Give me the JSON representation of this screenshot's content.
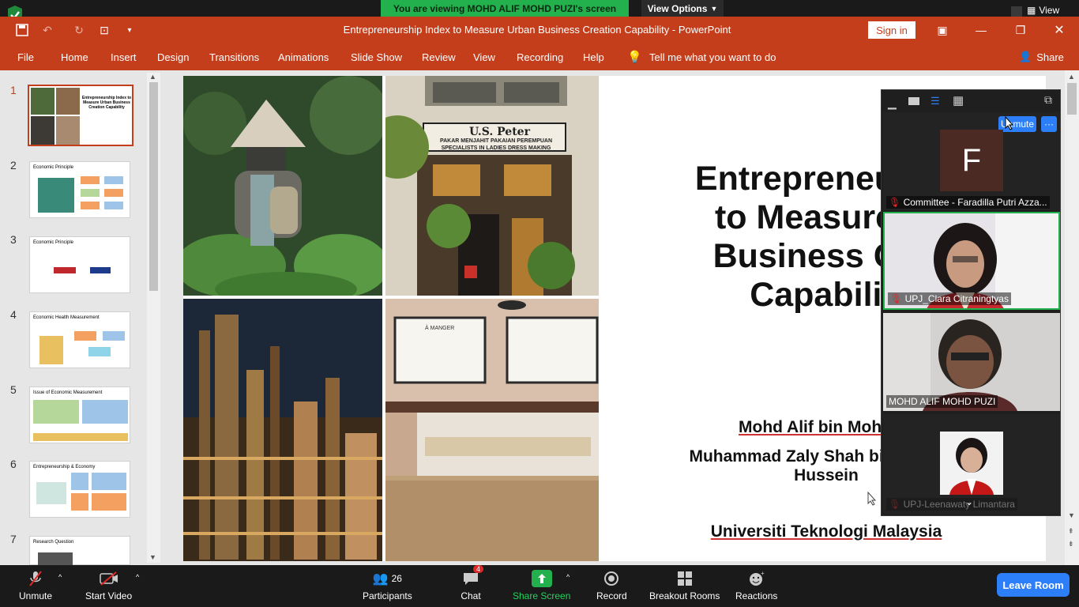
{
  "zoom": {
    "share_banner": "You are viewing MOHD ALIF MOHD PUZI's screen",
    "view_options": "View Options",
    "top_view": "View",
    "bottom": {
      "unmute": "Unmute",
      "start_video": "Start Video",
      "participants": "Participants",
      "participants_count": "26",
      "chat": "Chat",
      "chat_badge": "4",
      "share_screen": "Share Screen",
      "record": "Record",
      "breakout_rooms": "Breakout Rooms",
      "reactions": "Reactions",
      "leave_room": "Leave Room"
    },
    "gallery": {
      "unmute_label": "Unmute",
      "more_label": "···",
      "participants": [
        {
          "name": "Committee - Faradilla Putri Azza...",
          "avatar_letter": "F",
          "muted": true
        },
        {
          "name": "UPJ_Clara Citraningtyas",
          "muted": true
        },
        {
          "name": "MOHD ALIF MOHD PUZI",
          "muted": false
        },
        {
          "name": "UPJ-Leenawaty Limantara",
          "muted": true
        }
      ]
    }
  },
  "ppt": {
    "doc_title": "Entrepreneurship Index to Measure Urban Business Creation Capability  -  PowerPoint",
    "sign_in": "Sign in",
    "share": "Share",
    "tabs": [
      "File",
      "Home",
      "Insert",
      "Design",
      "Transitions",
      "Animations",
      "Slide Show",
      "Review",
      "View",
      "Recording",
      "Help"
    ],
    "tell_me": "Tell me what you want to do",
    "thumbnails": [
      {
        "num": "1",
        "title": "Entrepreneurship Index to Measure Urban Business Creation Capability"
      },
      {
        "num": "2",
        "title": "Economic Principle"
      },
      {
        "num": "3",
        "title": "Economic Principle"
      },
      {
        "num": "4",
        "title": "Economic Health Measurement"
      },
      {
        "num": "5",
        "title": "Issue of Economic Measurement"
      },
      {
        "num": "6",
        "title": "Entrepreneurship & Economy"
      },
      {
        "num": "7",
        "title": "Research Question"
      }
    ],
    "slide": {
      "title": "Entrepreneursh\nto Measure U\nBusiness Cre\nCapabilit",
      "author1": "Mohd Alif bin Mohd",
      "author2_line1": "Muhammad Zaly Shah bin",
      "author2_line2": "Hussein",
      "university": "Universiti Teknologi Malaysia",
      "shop_sign_line1": "U.S. Peter",
      "shop_sign_line2": "PAKAR MENJAHIT PAKAIAN PEREMPUAN",
      "shop_sign_line3": "SPECIALISTS IN LADIES DRESS MAKING",
      "cafe_board": "À MANGER"
    }
  },
  "colors": {
    "ppt_red": "#c43e1c",
    "zoom_green": "#22b14c",
    "zoom_blue": "#2d7ff9",
    "muted_red": "#e02828"
  }
}
